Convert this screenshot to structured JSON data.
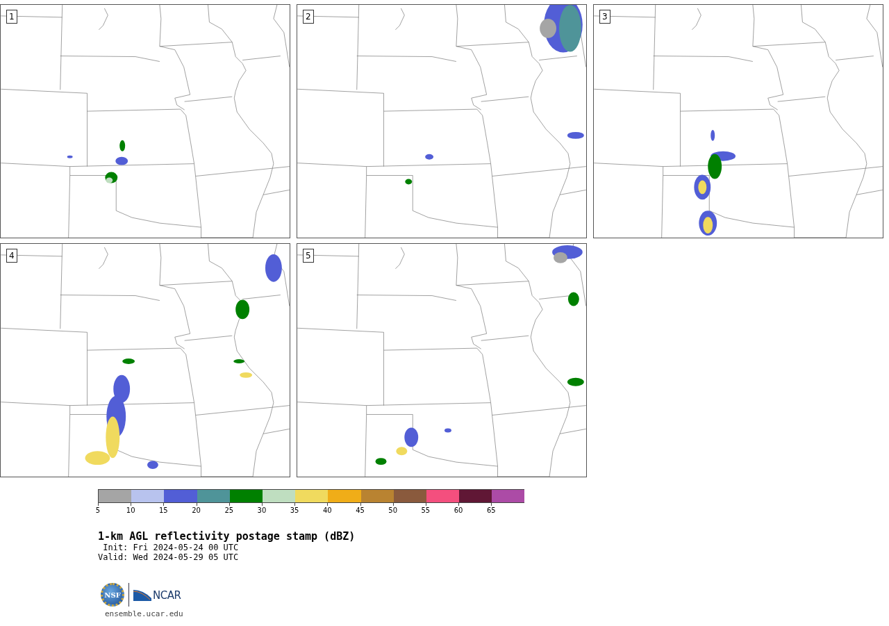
{
  "panels": [
    {
      "label": "1"
    },
    {
      "label": "2"
    },
    {
      "label": "3"
    },
    {
      "label": "4"
    },
    {
      "label": "5"
    }
  ],
  "colorbar": {
    "segments": [
      {
        "color": "#a5a5a5"
      },
      {
        "color": "#b8c3ee"
      },
      {
        "color": "#525ed6"
      },
      {
        "color": "#4f9499"
      },
      {
        "color": "#008000"
      },
      {
        "color": "#bfdec0"
      },
      {
        "color": "#f0da5e"
      },
      {
        "color": "#f0ad18"
      },
      {
        "color": "#b98331"
      },
      {
        "color": "#8a5a3d"
      },
      {
        "color": "#f44f7e"
      },
      {
        "color": "#601735"
      },
      {
        "color": "#ac4ba6"
      }
    ],
    "ticks": [
      "5",
      "10",
      "15",
      "20",
      "25",
      "30",
      "35",
      "40",
      "45",
      "50",
      "55",
      "60",
      "65"
    ]
  },
  "title": "1-km AGL reflectivity postage stamp (dBZ)",
  "init": " Init: Fri 2024-05-24 00 UTC",
  "valid": "Valid: Wed 2024-05-29 05 UTC",
  "logo": {
    "nsf": "NSF",
    "ncar": "NCAR"
  },
  "url": "ensemble.ucar.edu"
}
